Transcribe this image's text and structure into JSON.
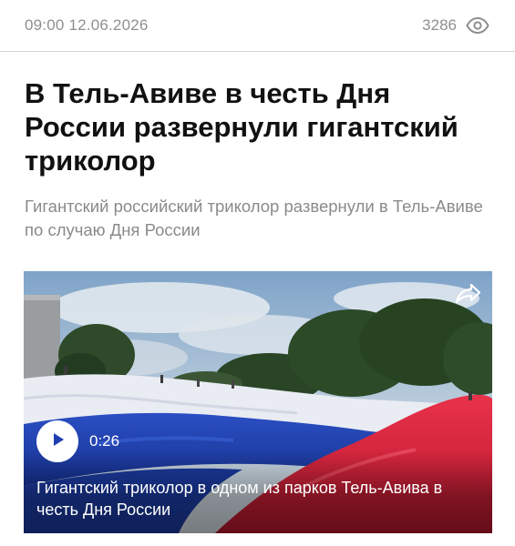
{
  "meta": {
    "datetime": "09:00 12.06.2026",
    "views": "3286",
    "views_icon": "eye-icon"
  },
  "article": {
    "title": "В Тель-Авиве в честь Дня России развернули гигантский триколор",
    "lede": "Гигантский российский триколор развернули в Тель-Авиве по случаю Дня России"
  },
  "video": {
    "duration": "0:26",
    "caption": "Гигантский триколор в одном из парков Тель-Авива в честь Дня России",
    "share_icon": "share-icon",
    "play_icon": "play-icon"
  },
  "colors": {
    "meta_text": "#8f8f8f",
    "title_text": "#111111",
    "lede_text": "#8a8a8a",
    "flag_white": "#e9ecf3",
    "flag_blue": "#1f3fb0",
    "flag_red": "#d9233a"
  }
}
